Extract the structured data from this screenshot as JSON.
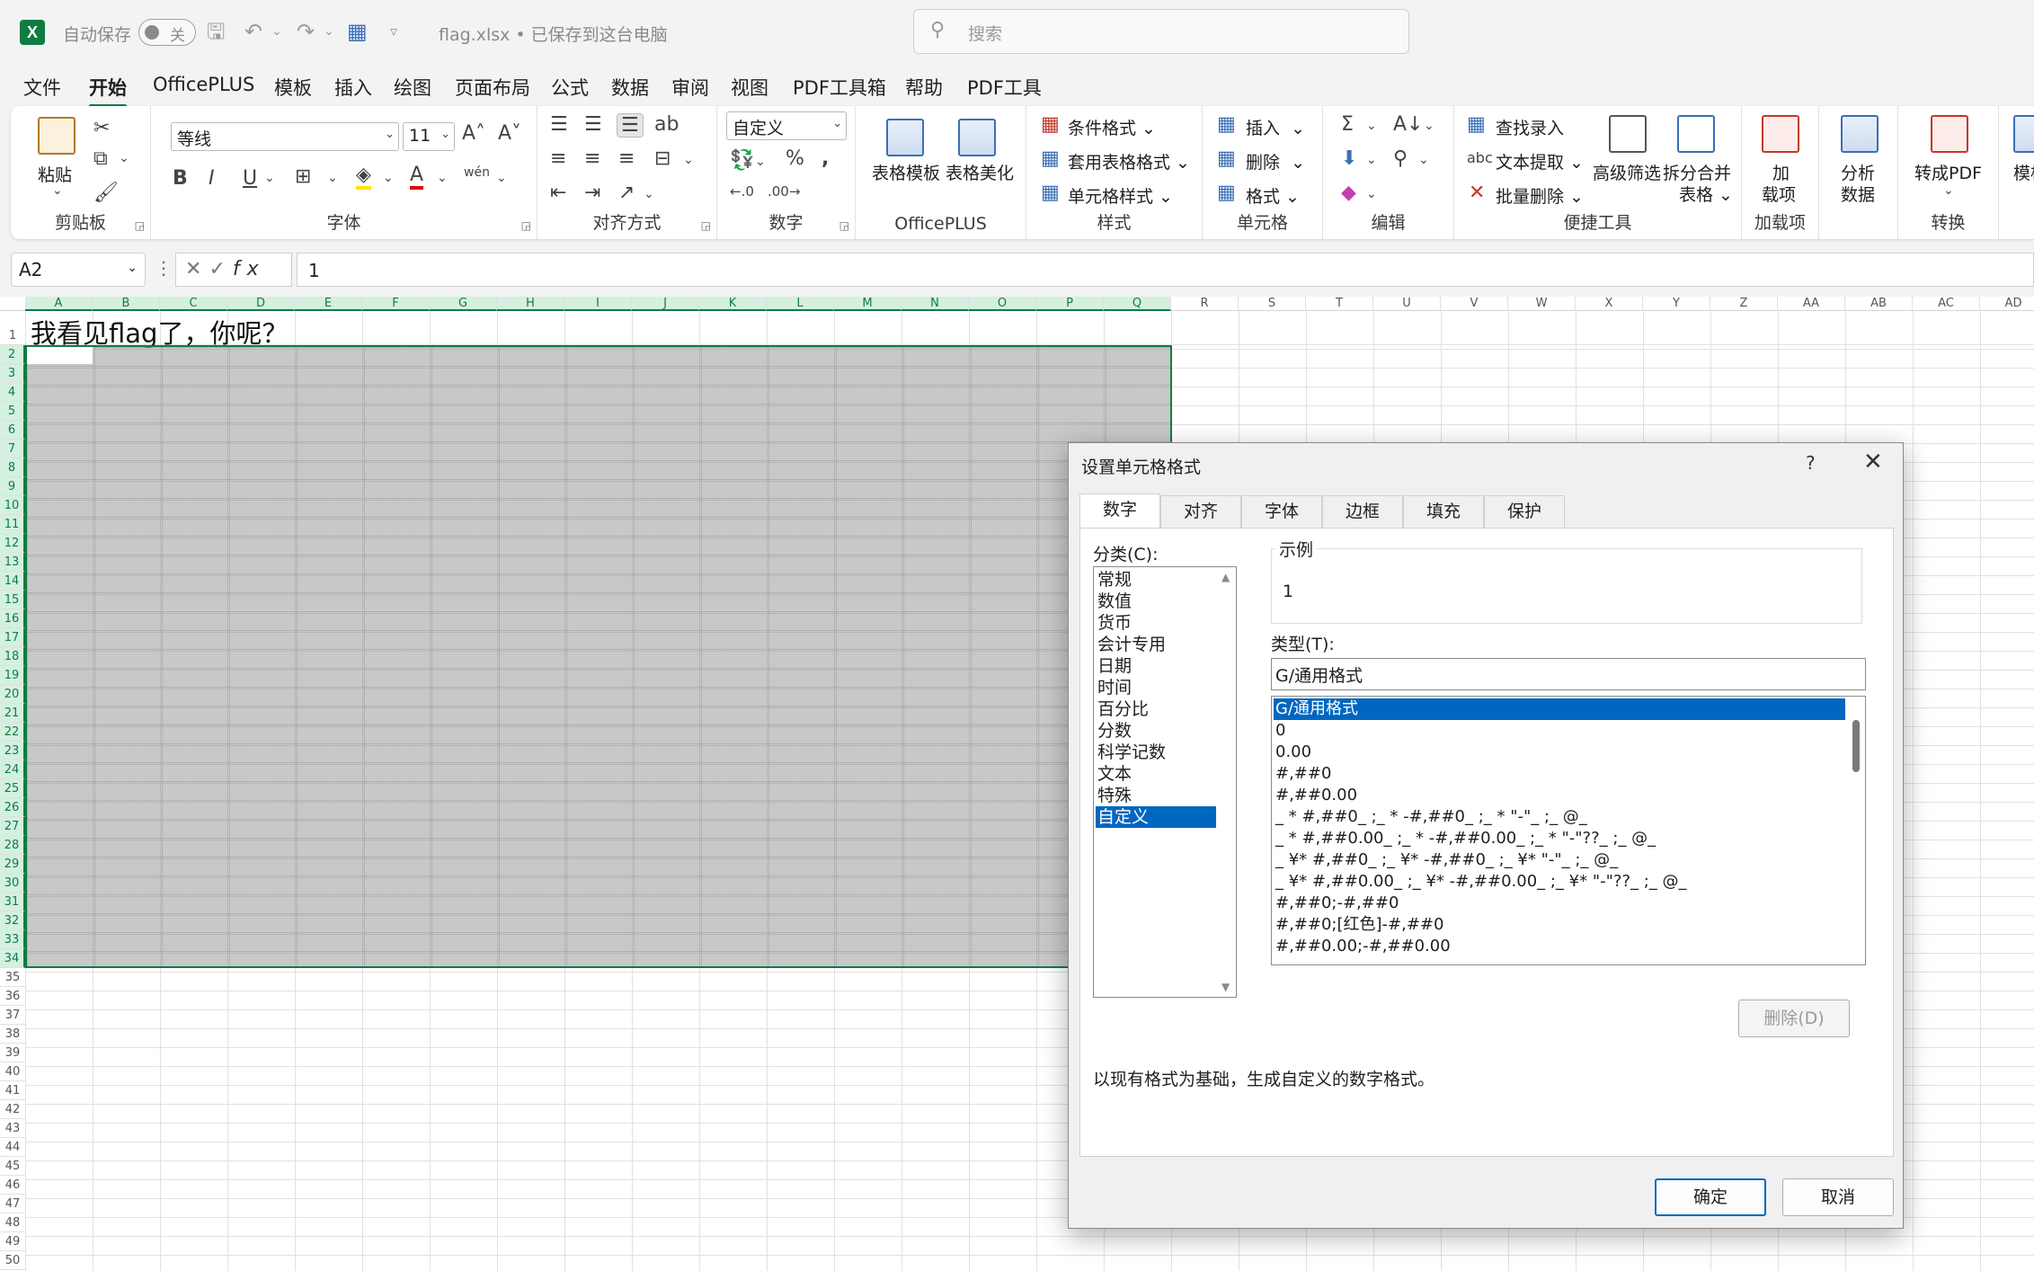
{
  "titlebar": {
    "autosave_label": "自动保存",
    "autosave_state": "关",
    "filename": "flag.xlsx • 已保存到这台电脑",
    "search_placeholder": "搜索"
  },
  "menu": [
    "文件",
    "开始",
    "OfficePLUS",
    "模板",
    "插入",
    "绘图",
    "页面布局",
    "公式",
    "数据",
    "审阅",
    "视图",
    "PDF工具箱",
    "帮助",
    "PDF工具"
  ],
  "menu_active_index": 1,
  "ribbon": {
    "clipboard": {
      "paste": "粘贴",
      "label": "剪贴板"
    },
    "font": {
      "name": "等线",
      "size": "11",
      "label": "字体"
    },
    "align": {
      "label": "对齐方式"
    },
    "number": {
      "format": "自定义",
      "label": "数字"
    },
    "officeplus": {
      "table_template": "表格模板",
      "table_beautify": "表格美化",
      "label": "OfficePLUS"
    },
    "styles": {
      "cond": "条件格式",
      "table_style": "套用表格格式",
      "cell_style": "单元格样式",
      "label": "样式"
    },
    "cells": {
      "insert": "插入",
      "delete": "删除",
      "format": "格式",
      "label": "单元格"
    },
    "edit": {
      "label": "编辑"
    },
    "quick": {
      "lookup": "查找录入",
      "extract": "文本提取",
      "batch_delete": "批量删除",
      "adv_filter": "高级筛选",
      "split_merge_1": "拆分合并",
      "split_merge_2": "表格",
      "label": "便捷工具"
    },
    "addins": {
      "line1": "加",
      "line2": "载项",
      "label": "加载项"
    },
    "analyze": {
      "line1": "分析",
      "line2": "数据"
    },
    "convert": {
      "to_pdf": "转成PDF",
      "label": "转换"
    },
    "template": {
      "label": "模板"
    }
  },
  "formula_bar": {
    "name_box": "A2",
    "value": "1"
  },
  "sheet": {
    "columns": [
      "A",
      "B",
      "C",
      "D",
      "E",
      "F",
      "G",
      "H",
      "I",
      "J",
      "K",
      "L",
      "M",
      "N",
      "O",
      "P",
      "Q",
      "R",
      "S",
      "T",
      "U",
      "V",
      "W",
      "X",
      "Y",
      "Z",
      "AA",
      "AB",
      "AC",
      "AD"
    ],
    "rows": [
      "1",
      "2",
      "3",
      "4",
      "5",
      "6",
      "7",
      "8",
      "9",
      "10",
      "11",
      "12",
      "13",
      "14",
      "15",
      "16",
      "17",
      "18",
      "19",
      "20",
      "21",
      "22",
      "23",
      "24",
      "25",
      "26",
      "27",
      "28",
      "29",
      "30",
      "31",
      "32",
      "33",
      "34",
      "35",
      "36",
      "37",
      "38",
      "39",
      "40",
      "41",
      "42",
      "43",
      "44",
      "45",
      "46",
      "47",
      "48",
      "49",
      "50"
    ],
    "a1": "我看见flag了，你呢？"
  },
  "dialog": {
    "title": "设置单元格格式",
    "help": "?",
    "close": "✕",
    "tabs": [
      "数字",
      "对齐",
      "字体",
      "边框",
      "填充",
      "保护"
    ],
    "category_label": "分类(C):",
    "categories": [
      "常规",
      "数值",
      "货币",
      "会计专用",
      "日期",
      "时间",
      "百分比",
      "分数",
      "科学记数",
      "文本",
      "特殊",
      "自定义"
    ],
    "category_selected": 11,
    "sample_label": "示例",
    "sample_value": "1",
    "type_label": "类型(T):",
    "type_value": "G/通用格式",
    "formats": [
      "G/通用格式",
      "0",
      "0.00",
      "#,##0",
      "#,##0.00",
      "_ * #,##0_ ;_ * -#,##0_ ;_ * \"-\"_ ;_ @_",
      "_ * #,##0.00_ ;_ * -#,##0.00_ ;_ * \"-\"??_ ;_ @_",
      "_ ¥* #,##0_ ;_ ¥* -#,##0_ ;_ ¥* \"-\"_ ;_ @_",
      "_ ¥* #,##0.00_ ;_ ¥* -#,##0.00_ ;_ ¥* \"-\"??_ ;_ @_",
      "#,##0;-#,##0",
      "#,##0;[红色]-#,##0",
      "#,##0.00;-#,##0.00"
    ],
    "format_selected": 0,
    "delete_button": "删除(D)",
    "description": "以现有格式为基础，生成自定义的数字格式。",
    "ok": "确定",
    "cancel": "取消"
  }
}
